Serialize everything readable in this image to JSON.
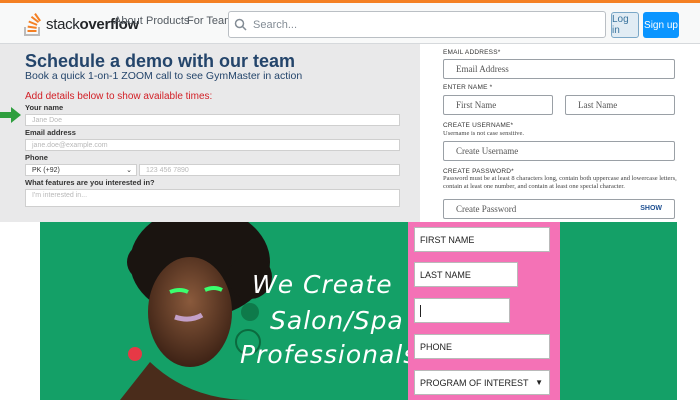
{
  "header": {
    "logo": {
      "part1": "stack",
      "part2": "overflow"
    },
    "nav": [
      "About",
      "Products",
      "For Teams"
    ],
    "search_placeholder": "Search...",
    "login_label": "Log in",
    "signup_label": "Sign up"
  },
  "demo": {
    "title": "Schedule a demo with our team",
    "subtitle": "Book a quick 1-on-1 ZOOM call to see GymMaster in action",
    "add_details": "Add details below to show available times:",
    "name_label": "Your name",
    "name_placeholder": "Jane Doe",
    "email_label": "Email address",
    "email_placeholder": "jane.doe@example.com",
    "phone_label": "Phone",
    "phone_country": "PK (+92)",
    "phone_placeholder": "123 456 7890",
    "features_label": "What features are you interested in?",
    "features_placeholder": "I'm interested in..."
  },
  "registration": {
    "email_label": "EMAIL ADDRESS*",
    "email_placeholder": "Email Address",
    "name_label": "ENTER NAME *",
    "first_placeholder": "First Name",
    "last_placeholder": "Last Name",
    "username_label": "CREATE USERNAME*",
    "username_help": "Username is not case sensitive.",
    "username_placeholder": "Create Username",
    "password_label": "CREATE PASSWORD*",
    "password_help": "Password must be at least 8 characters long, contain both uppercase and lowercase letters, contain at least one number, and contain at least one special character.",
    "password_placeholder": "Create Password",
    "show_label": "SHOW"
  },
  "promo": {
    "line1": "We Create",
    "line2": "Salon/Spa",
    "line3": "Professionals",
    "first_name": "FIRST NAME",
    "last_name": "LAST NAME",
    "phone": "PHONE",
    "program": "PROGRAM OF INTEREST"
  },
  "colors": {
    "so_orange": "#f48024",
    "so_blue": "#0a95ff",
    "demo_title": "#24456b",
    "promo_green": "#14a067",
    "promo_pink": "#f472b6"
  }
}
